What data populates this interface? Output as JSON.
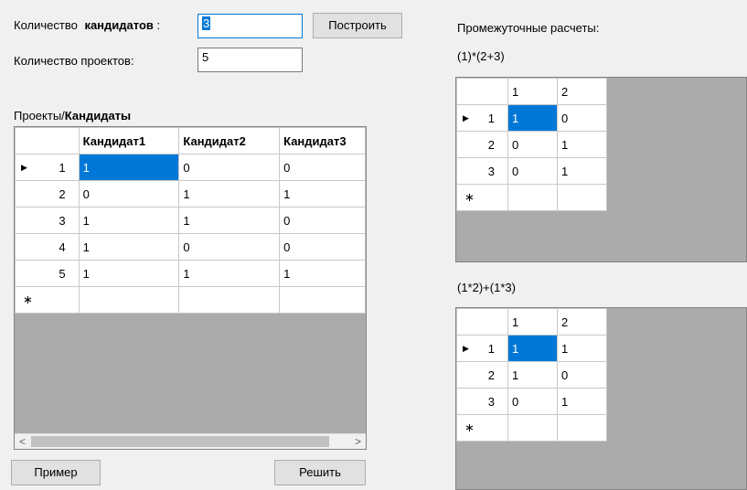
{
  "top": {
    "candidates_label_a": "Количество",
    "candidates_label_b": "кандидатов",
    "candidates_label_c": " :",
    "candidates_value": "3",
    "projects_label": "Количество проектов:",
    "projects_value": "5",
    "build_button": "Построить"
  },
  "main_grid": {
    "caption_a": "Проекты/",
    "caption_b": "Кандидаты",
    "columns": [
      "Кандидат1",
      "Кандидат2",
      "Кандидат3"
    ],
    "rows": [
      {
        "n": "1",
        "cells": [
          "1",
          "0",
          "0"
        ]
      },
      {
        "n": "2",
        "cells": [
          "0",
          "1",
          "1"
        ]
      },
      {
        "n": "3",
        "cells": [
          "1",
          "1",
          "0"
        ]
      },
      {
        "n": "4",
        "cells": [
          "1",
          "0",
          "0"
        ]
      },
      {
        "n": "5",
        "cells": [
          "1",
          "1",
          "1"
        ]
      }
    ],
    "scroll_left": "<",
    "scroll_right": ">"
  },
  "buttons": {
    "example": "Пример",
    "solve": "Решить"
  },
  "right": {
    "title": "Промежуточные расчеты:",
    "formula1": "(1)*(2+3)",
    "grid1": {
      "columns": [
        "1",
        "2"
      ],
      "rows": [
        {
          "n": "1",
          "cells": [
            "1",
            "0"
          ]
        },
        {
          "n": "2",
          "cells": [
            "0",
            "1"
          ]
        },
        {
          "n": "3",
          "cells": [
            "0",
            "1"
          ]
        }
      ]
    },
    "formula2": "(1*2)+(1*3)",
    "grid2": {
      "columns": [
        "1",
        "2"
      ],
      "rows": [
        {
          "n": "1",
          "cells": [
            "1",
            "1"
          ]
        },
        {
          "n": "2",
          "cells": [
            "1",
            "0"
          ]
        },
        {
          "n": "3",
          "cells": [
            "0",
            "1"
          ]
        }
      ]
    }
  },
  "icons": {
    "current_row": "row-pointer-icon",
    "new_row": "new-row-icon"
  }
}
